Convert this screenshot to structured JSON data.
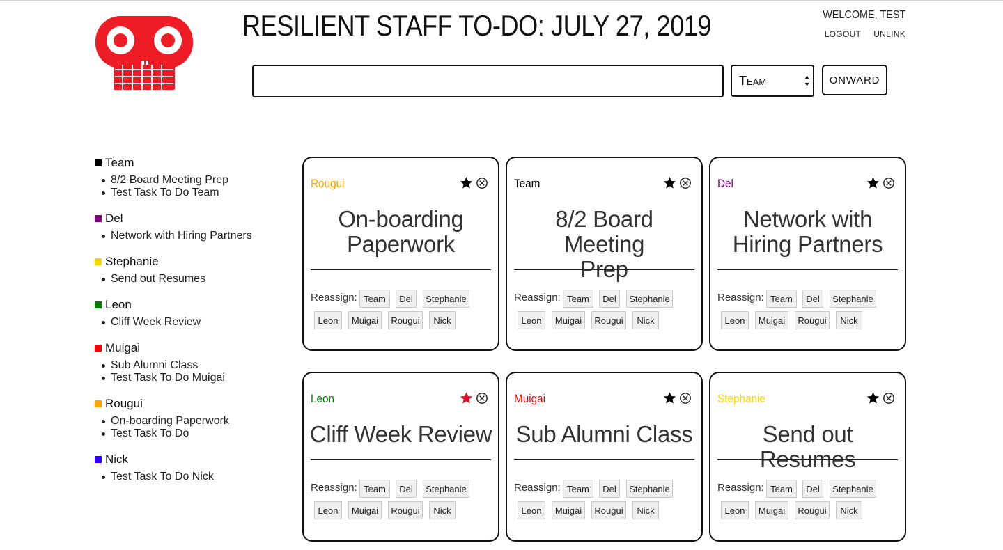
{
  "header": {
    "title": "RESILIENT STAFF TO-DO: JULY 27, 2019",
    "welcome": "WELCOME, TEST",
    "logout_label": "LOGOUT",
    "unlink_label": "UNLINK"
  },
  "search": {
    "value": "",
    "placeholder": ""
  },
  "assignee_select": {
    "selected": "Team"
  },
  "onward_label": "ONWARD",
  "colors": {
    "Team": "#000000",
    "Del": "#800080",
    "Stephanie": "#ffd700",
    "Leon": "#008000",
    "Muigai": "#ff0000",
    "Rougui": "#ffa500",
    "Nick": "#3300ff",
    "logo": "#ee1c24"
  },
  "roster": [
    {
      "name": "Team",
      "tasks": [
        "8/2 Board Meeting Prep",
        "Test Task To Do Team"
      ]
    },
    {
      "name": "Del",
      "tasks": [
        "Network with Hiring Partners"
      ]
    },
    {
      "name": "Stephanie",
      "tasks": [
        "Send out Resumes"
      ]
    },
    {
      "name": "Leon",
      "tasks": [
        "Cliff Week Review"
      ]
    },
    {
      "name": "Muigai",
      "tasks": [
        "Sub Alumni Class",
        "Test Task To Do Muigai"
      ]
    },
    {
      "name": "Rougui",
      "tasks": [
        "On-boarding Paperwork",
        "Test Task To Do"
      ]
    },
    {
      "name": "Nick",
      "tasks": [
        "Test Task To Do Nick"
      ]
    }
  ],
  "reassign_label": "Reassign:",
  "reassign_options": [
    "Team",
    "Del",
    "Stephanie",
    "Leon",
    "Muigai",
    "Rougui",
    "Nick"
  ],
  "cards": [
    {
      "owner": "Rougui",
      "title_lines": [
        "On-boarding",
        "Paperwork"
      ],
      "starred": false
    },
    {
      "owner": "Team",
      "title_lines": [
        "8/2 Board Meeting",
        "Prep"
      ],
      "starred": false
    },
    {
      "owner": "Del",
      "title_lines": [
        "Network with",
        "Hiring Partners"
      ],
      "starred": false
    },
    {
      "owner": "Leon",
      "title_lines": [
        "Cliff Week Review"
      ],
      "starred": true
    },
    {
      "owner": "Muigai",
      "title_lines": [
        "Sub Alumni Class"
      ],
      "starred": false
    },
    {
      "owner": "Stephanie",
      "title_lines": [
        "Send out Resumes"
      ],
      "starred": false
    }
  ]
}
